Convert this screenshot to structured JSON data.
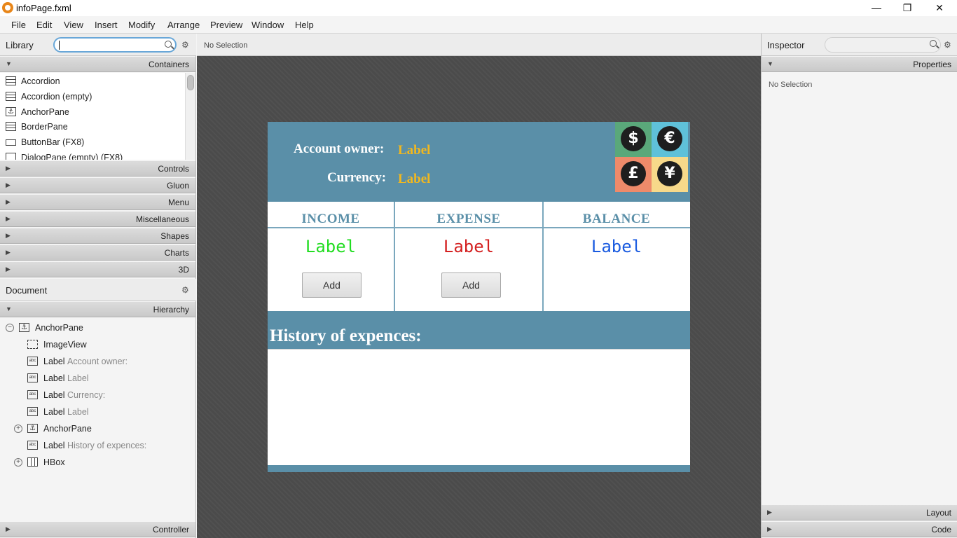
{
  "window": {
    "title": "infoPage.fxml",
    "minimize": "—",
    "maximize": "❐",
    "close": "✕"
  },
  "menu": [
    "File",
    "Edit",
    "View",
    "Insert",
    "Modify",
    "Arrange",
    "Preview",
    "Window",
    "Help"
  ],
  "library": {
    "title": "Library",
    "search_value": "",
    "sections": {
      "containers": "Containers",
      "controls": "Controls",
      "gluon": "Gluon",
      "menu": "Menu",
      "miscellaneous": "Miscellaneous",
      "shapes": "Shapes",
      "charts": "Charts",
      "threed": "3D"
    },
    "items": [
      "Accordion",
      "Accordion  (empty)",
      "AnchorPane",
      "BorderPane",
      "ButtonBar  (FX8)",
      "DialogPane (empty)  (FX8)"
    ]
  },
  "document": {
    "title": "Document",
    "hierarchy_label": "Hierarchy",
    "tree": [
      {
        "name": "AnchorPane",
        "sub": ""
      },
      {
        "name": "ImageView",
        "sub": ""
      },
      {
        "name": "Label",
        "sub": "Account owner:"
      },
      {
        "name": "Label",
        "sub": "Label"
      },
      {
        "name": "Label",
        "sub": "Currency:"
      },
      {
        "name": "Label",
        "sub": "Label"
      },
      {
        "name": "AnchorPane",
        "sub": ""
      },
      {
        "name": "Label",
        "sub": "History of expences:"
      },
      {
        "name": "HBox",
        "sub": ""
      }
    ],
    "controller_label": "Controller"
  },
  "center": {
    "status": "No Selection"
  },
  "form": {
    "account_owner_label": "Account owner:",
    "account_owner_value": "Label",
    "currency_label": "Currency:",
    "currency_value": "Label",
    "currency_symbols": [
      "$",
      "€",
      "£",
      "¥"
    ],
    "currency_colors": [
      "#5aa87a",
      "#5fc1d9",
      "#ee8a6a",
      "#f7d98a"
    ],
    "income_title": "INCOME",
    "income_value": "Label",
    "expense_title": "EXPENSE",
    "expense_value": "Label",
    "balance_title": "BALANCE",
    "balance_value": "Label",
    "add_label": "Add",
    "history_title": "History of expences:",
    "colors": {
      "header": "#5a8fa8",
      "income": "#22dd22",
      "expense": "#d42020",
      "balance": "#1a5be0",
      "value_label": "#f2b81e"
    }
  },
  "inspector": {
    "title": "Inspector",
    "properties_label": "Properties",
    "no_selection": "No Selection",
    "layout_label": "Layout",
    "code_label": "Code"
  }
}
